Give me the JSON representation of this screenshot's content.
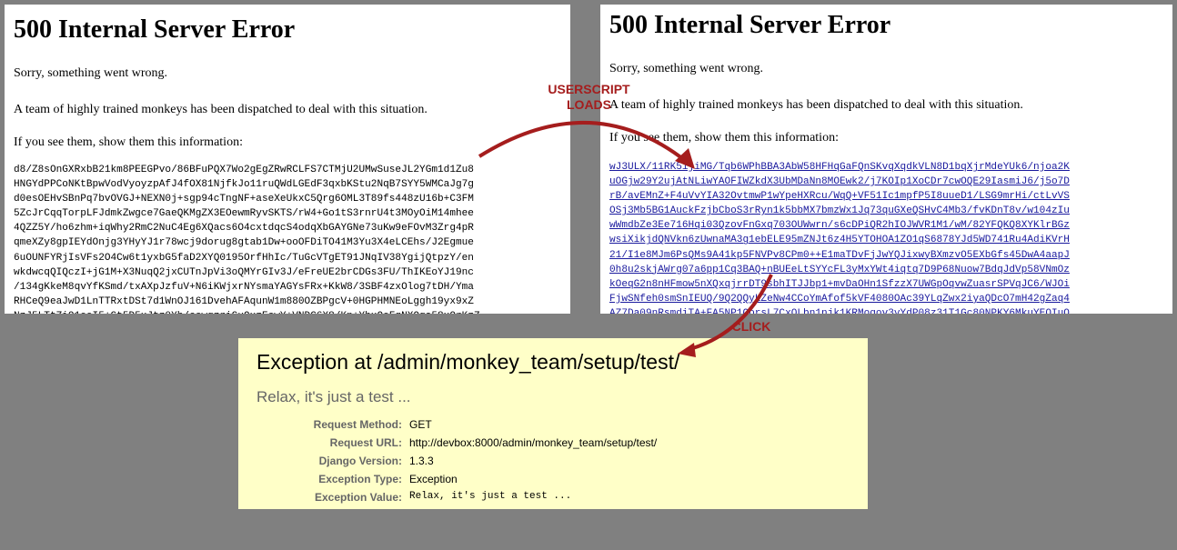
{
  "left_page": {
    "title": "500 Internal Server Error",
    "line1": "Sorry, something went wrong.",
    "line2": "A team of highly trained monkeys has been dispatched to deal with this situation.",
    "line3": "If you see them, show them this information:",
    "encoded_lines": [
      "d8/Z8sOnGXRxbB21km8PEEGPvo/86BFuPQX7Wo2gEgZRwRCLFS7CTMjU2UMwSuseJL2YGm1d1Zu8",
      "HNGYdPPCoNKtBpwVodVyoyzpAfJ4fOX81NjfkJo11ruQWdLGEdF3qxbKStu2NqB7SYY5WMCaJg7g",
      "d0esOEHvSBnPq7bvOVGJ+NEXN0j+sgp94cTngNF+aseXeUkxC5Qrg6OML3T89fs448zU16b+C3FM",
      "5ZcJrCqqTorpLFJdmkZwgce7GaeQKMgZX3EOewmRyvSKTS/rW4+Go1tS3rnrU4t3MOyOiM14mhee",
      "4QZZ5Y/ho6zhm+iqWhy2RmC2NuC4Eg6XQacs6O4cxtdqcS4odqXbGAYGNe73uKw9eFOvM3Zrg4pR",
      "qmeXZy8gpIEYdOnjg3YHyYJ1r78wcj9dorug8gtab1Dw+ooOFDiTO41M3Yu3X4eLCEhs/J2Egmue",
      "6uOUNFYRjIsVFs2O4Cw6t1yxbG5faD2XYQ0195OrfHhIc/TuGcVTgET91JNqIV38YgijQtpzY/en",
      "wkdwcqQIQczI+jG1M+X3NuqQ2jxCUTnJpVi3oQMYrGIv3J/eFreUE2brCDGs3FU/ThIKEoYJ19nc",
      "/134gKkeM8qvYfKSmd/txAXpJzfuV+N6iKWjxrNYsmaYAGYsFRx+KkW8/3SBF4zxOlog7tDH/Yma",
      "RHCeQ9eaJwD1LnTTRxtDSt7d1WnOJ161DvehAFAqunW1m880OZBPgcV+0HGPHMNEoLggh19yx9xZ",
      "NzJ5LTtZiO1oeI5+Gt5D5xJtz0Yb/ccwqzriGuQxzEcwY+VNDC6X8/Kn+YbxQoFqNXQqa58xOrKzZ"
    ]
  },
  "right_page": {
    "title": "500 Internal Server Error",
    "line1": "Sorry, something went wrong.",
    "line2": "A team of highly trained monkeys has been dispatched to deal with this situation.",
    "line3": "If you see them, show them this information:",
    "encoded_lines": [
      "wJ3ULX/11RK5ijiMG/Tqb6WPhBBA3AbW58HFHqGaFQnSKvqXqdkVLN8D1bqXjrMdeYUk6/njoa2K",
      "uOGjw29Y2ujAtNLiwYAOFIWZkdX3UbMDaNn8MOEwk2/j7KOIp1XoCDr7cwOQE29IasmiJ6/j5o7D",
      "rB/avEMnZ+F4uVvYIA32OvtmwP1wYpeHXRcu/WqQ+VF51Ic1mpfP5I8uueD1/LSG9mrHi/ctLvVS",
      "OSj3Mb5BG1AuckFzjbCboS3rRyn1k5bbMX7bmzWx1Jq73quGXeQSHvC4Mb3/fvKDnT8v/w104zIu",
      "wWmdbZe3Ee716Hqi03QzovFnGxq703OUWwrn/s6cDPiQR2hIOJWVR1M1/wM/82YFQKQ8XYKlrBGz",
      "wsiXikjdQNVkn6zUwnaMA3g1ebELE95mZNJt6z4H5YTOHOA1ZO1qS6878YJd5WD741Ru4AdiKVrH",
      "21/I1e8MJm6PsQMs9A41kp5FNVPv8CPm0++E1maTDvFjJwYQJixwyBXmzvO5EXbGfs45DwA4aapJ",
      "0h8u2skjAWrg07a6pp1Cq3BAQ+nBUEeLtSYYcFL3yMxYWt4iqtq7D9P68Nuow7BdqJdVp58VNmOz",
      "kOeqG2n8nHFmow5nXQxqjrrDT9sbhITJJbp1+mvDaOHn1SfzzX7UWGpOqvwZuasrSPVqJC6/WJOi",
      "FjwSNfeh0smSnIEUQ/9Q2QQyLZeNw4CCoYmAfof5kVF4080OAc39YLqZwx2iyaQDcO7mH42gZaq4",
      "AZ7Da09nRsmdiTA+FA5NP1QorsL7CxOLbn1njk1KRMoqov3yYdP08z31T1Gc80NPKY6MkuYEOIuO"
    ]
  },
  "annotations": {
    "userscript": "USERSCRIPT\nLOADS",
    "click": "CLICK",
    "arrow_color": "#a51d1d"
  },
  "django": {
    "title": "Exception at /admin/monkey_team/setup/test/",
    "subtitle": "Relax, it's just a test ...",
    "rows": [
      {
        "key": "Request Method:",
        "value": "GET"
      },
      {
        "key": "Request URL:",
        "value": "http://devbox:8000/admin/monkey_team/setup/test/"
      },
      {
        "key": "Django Version:",
        "value": "1.3.3"
      },
      {
        "key": "Exception Type:",
        "value": "Exception"
      },
      {
        "key": "Exception Value:",
        "value": "Relax, it's just a test ..."
      }
    ]
  },
  "colors": {
    "background": "#808080",
    "django_bg": "#ffffc8",
    "link_blue": "#1a1a9e"
  }
}
